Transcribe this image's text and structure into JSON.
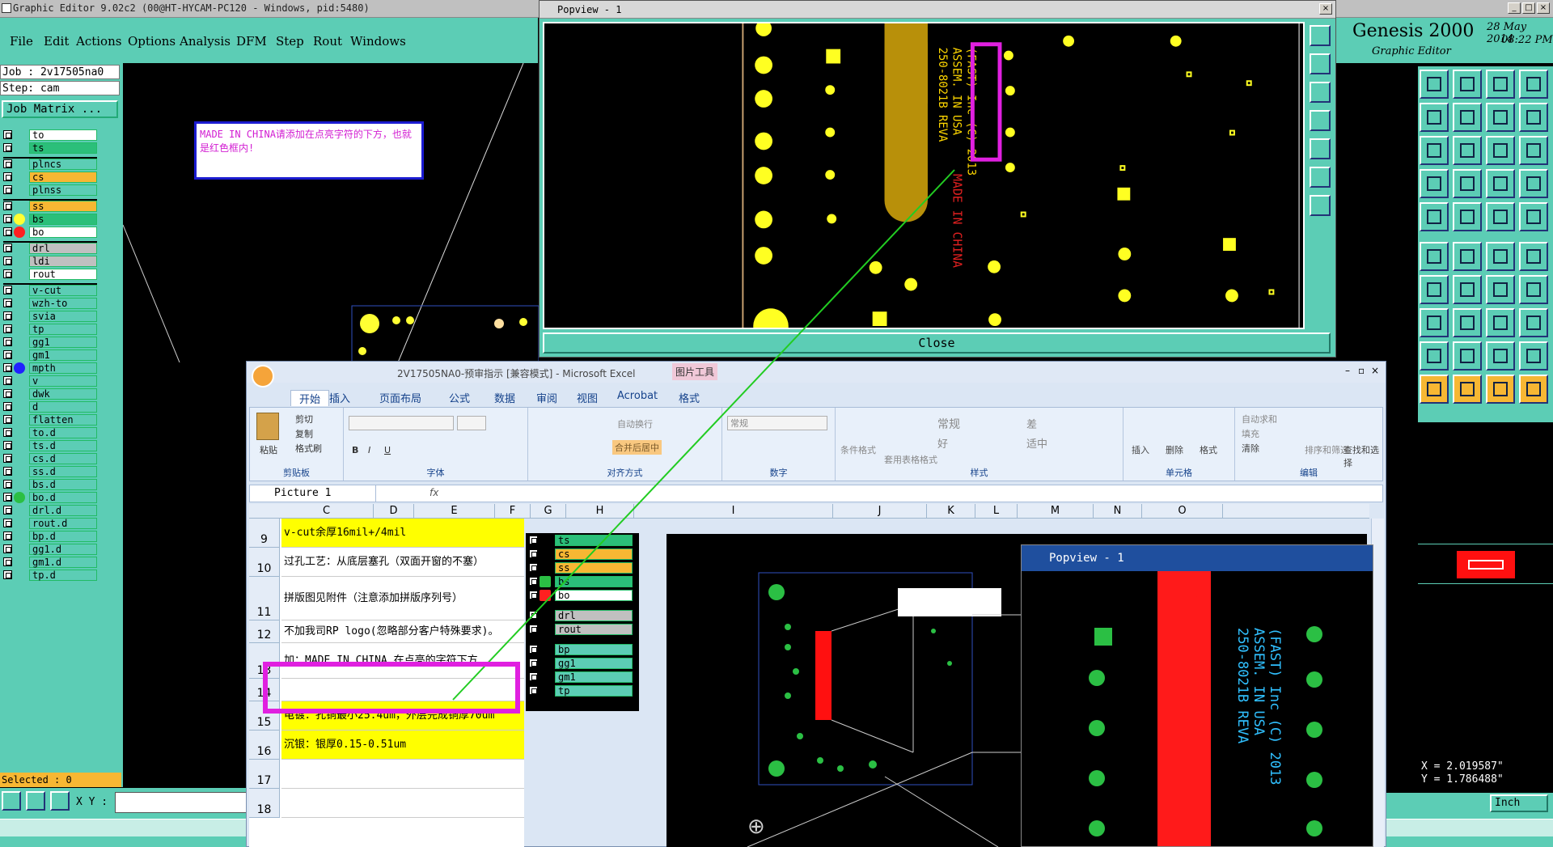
{
  "genesis": {
    "title": "Graphic Editor 9.02c2 (00@HT-HYCAM-PC120 - Windows, pid:5480)",
    "menu": [
      "File",
      "Edit",
      "Actions",
      "Options",
      "Analysis",
      "DFM",
      "Step",
      "Rout",
      "Windows"
    ],
    "job_line": "Job : 2v17505na0",
    "step_line": "Step: cam",
    "job_matrix": "Job Matrix ...",
    "layers": [
      {
        "name": "to",
        "color": "#ffffff",
        "dot": ""
      },
      {
        "name": "ts",
        "color": "#2bbf7a",
        "dot": ""
      },
      {
        "name": "plncs",
        "color": "#5ccdb5",
        "dot": ""
      },
      {
        "name": "cs",
        "color": "#f7b733",
        "dot": ""
      },
      {
        "name": "plnss",
        "color": "#5ccdb5",
        "dot": ""
      },
      {
        "name": "ss",
        "color": "#f7b733",
        "dot": ""
      },
      {
        "name": "bs",
        "color": "#2bbf7a",
        "dot": "#ffff33"
      },
      {
        "name": "bo",
        "color": "#ffffff",
        "dot": "#ff2020"
      },
      {
        "name": "drl",
        "color": "#c0c0c0",
        "dot": ""
      },
      {
        "name": "ldi",
        "color": "#c0c0c0",
        "dot": ""
      },
      {
        "name": "rout",
        "color": "#ffffff",
        "dot": ""
      },
      {
        "name": "v-cut",
        "color": "#5ccdb5",
        "dot": ""
      },
      {
        "name": "wzh-to",
        "color": "#5ccdb5",
        "dot": ""
      },
      {
        "name": "svia",
        "color": "#5ccdb5",
        "dot": ""
      },
      {
        "name": "tp",
        "color": "#5ccdb5",
        "dot": ""
      },
      {
        "name": "gg1",
        "color": "#5ccdb5",
        "dot": ""
      },
      {
        "name": "gm1",
        "color": "#5ccdb5",
        "dot": ""
      },
      {
        "name": "mpth",
        "color": "#5ccdb5",
        "dot": "#2020ff"
      },
      {
        "name": "v",
        "color": "#5ccdb5",
        "dot": ""
      },
      {
        "name": "dwk",
        "color": "#5ccdb5",
        "dot": ""
      },
      {
        "name": "d",
        "color": "#5ccdb5",
        "dot": ""
      },
      {
        "name": "flatten",
        "color": "#5ccdb5",
        "dot": ""
      },
      {
        "name": "to.d",
        "color": "#5ccdb5",
        "dot": ""
      },
      {
        "name": "ts.d",
        "color": "#5ccdb5",
        "dot": ""
      },
      {
        "name": "cs.d",
        "color": "#5ccdb5",
        "dot": ""
      },
      {
        "name": "ss.d",
        "color": "#5ccdb5",
        "dot": ""
      },
      {
        "name": "bs.d",
        "color": "#5ccdb5",
        "dot": ""
      },
      {
        "name": "bo.d",
        "color": "#5ccdb5",
        "dot": "#2bbf44"
      },
      {
        "name": "drl.d",
        "color": "#5ccdb5",
        "dot": ""
      },
      {
        "name": "rout.d",
        "color": "#5ccdb5",
        "dot": ""
      },
      {
        "name": "bp.d",
        "color": "#5ccdb5",
        "dot": ""
      },
      {
        "name": "gg1.d",
        "color": "#5ccdb5",
        "dot": ""
      },
      {
        "name": "gm1.d",
        "color": "#5ccdb5",
        "dot": ""
      },
      {
        "name": "tp.d",
        "color": "#5ccdb5",
        "dot": ""
      }
    ],
    "selected": "Selected : 0",
    "xy_label": "X Y :",
    "units": "Inch",
    "brand": "Genesis 2000",
    "brand_sub": "Graphic Editor",
    "date": "28 May 2014",
    "time": "08:22 PM",
    "coord_x": "X = 2.019587\"",
    "coord_y": "Y = 1.786488\""
  },
  "note": "MADE IN CHINA请添加在点亮字符的下方，也就是红色框内!",
  "popview_top": {
    "title": "Popview - 1",
    "close": "Close",
    "silk_text": [
      "250-8021B REVA",
      "ASSEM. IN USA",
      "(FAST) Inc (C) 2013"
    ],
    "made_in_china": "MADE IN CHINA"
  },
  "excel": {
    "title": "2V17505NA0-预审指示 [兼容模式] - Microsoft Excel",
    "picture_tools": "图片工具",
    "tabs": [
      "开始",
      "插入",
      "页面布局",
      "公式",
      "数据",
      "审阅",
      "视图",
      "Acrobat",
      "格式"
    ],
    "ribbon": {
      "clipboard": {
        "label": "剪贴板",
        "paste": "粘贴",
        "cut": "剪切",
        "copy": "复制",
        "painter": "格式刷"
      },
      "font": {
        "label": "字体"
      },
      "align": {
        "label": "对齐方式",
        "wrap": "自动换行",
        "merge": "合并后居中"
      },
      "number": {
        "label": "数字",
        "format": "常规"
      },
      "styles": {
        "label": "样式",
        "cond": "条件格式",
        "table": "套用表格格式",
        "normal": "常规",
        "bad": "差",
        "good": "好",
        "neutral": "适中"
      },
      "cells": {
        "label": "单元格",
        "insert": "插入",
        "delete": "删除",
        "format": "格式"
      },
      "edit": {
        "label": "编辑",
        "autosum": "自动求和",
        "fill": "填充",
        "clear": "清除",
        "sort": "排序和筛选",
        "find": "查找和选择"
      }
    },
    "name_box": "Picture 1",
    "fx": "fx",
    "columns": [
      "C",
      "D",
      "E",
      "F",
      "G",
      "H",
      "I",
      "J",
      "K",
      "L",
      "M",
      "N",
      "O"
    ],
    "rows": [
      {
        "n": "9",
        "text": "v-cut余厚16mil+/4mil",
        "fill": "#ffff00"
      },
      {
        "n": "10",
        "text": "过孔工艺：从底层塞孔（双面开窗的不塞）",
        "fill": "#ffffff"
      },
      {
        "n": "11",
        "text": "拼版图见附件（注意添加拼版序列号）",
        "fill": "#ffffff"
      },
      {
        "n": "12",
        "text": "不加我司RP logo(忽略部分客户特殊要求)。",
        "fill": "#ffffff"
      },
      {
        "n": "13",
        "text": "加：MADE IN CHINA  在点亮的字符下方",
        "fill": "#ffffff"
      },
      {
        "n": "14",
        "text": "",
        "fill": "#ffffff"
      },
      {
        "n": "15",
        "text": "电镀：孔铜最小25.4um，外层完成铜厚70um",
        "fill": "#ffff00"
      },
      {
        "n": "16",
        "text": "沉银：银厚0.15-0.51um",
        "fill": "#ffff00"
      },
      {
        "n": "17",
        "text": "",
        "fill": "#ffffff"
      },
      {
        "n": "18",
        "text": "",
        "fill": "#ffffff"
      }
    ],
    "pasted_layers": [
      {
        "name": "ts",
        "color": "#2bbf7a",
        "dot": ""
      },
      {
        "name": "cs",
        "color": "#f7b733",
        "dot": ""
      },
      {
        "name": "ss",
        "color": "#f7b733",
        "dot": ""
      },
      {
        "name": "bs",
        "color": "#2bbf7a",
        "dot": "#2bbf44"
      },
      {
        "name": "bo",
        "color": "#ffffff",
        "dot": "#ff2020"
      },
      {
        "name": "drl",
        "color": "#c0c0c0",
        "dot": ""
      },
      {
        "name": "rout",
        "color": "#c0c0c0",
        "dot": ""
      },
      {
        "name": "bp",
        "color": "#5ccdb5",
        "dot": ""
      },
      {
        "name": "gg1",
        "color": "#5ccdb5",
        "dot": ""
      },
      {
        "name": "gm1",
        "color": "#5ccdb5",
        "dot": ""
      },
      {
        "name": "tp",
        "color": "#5ccdb5",
        "dot": ""
      }
    ]
  },
  "popview_bottom": {
    "title": "Popview - 1",
    "silk_text": [
      "250-8021B REVA",
      "ASSEM. IN USA",
      "(FAST) Inc (C) 2013"
    ]
  }
}
